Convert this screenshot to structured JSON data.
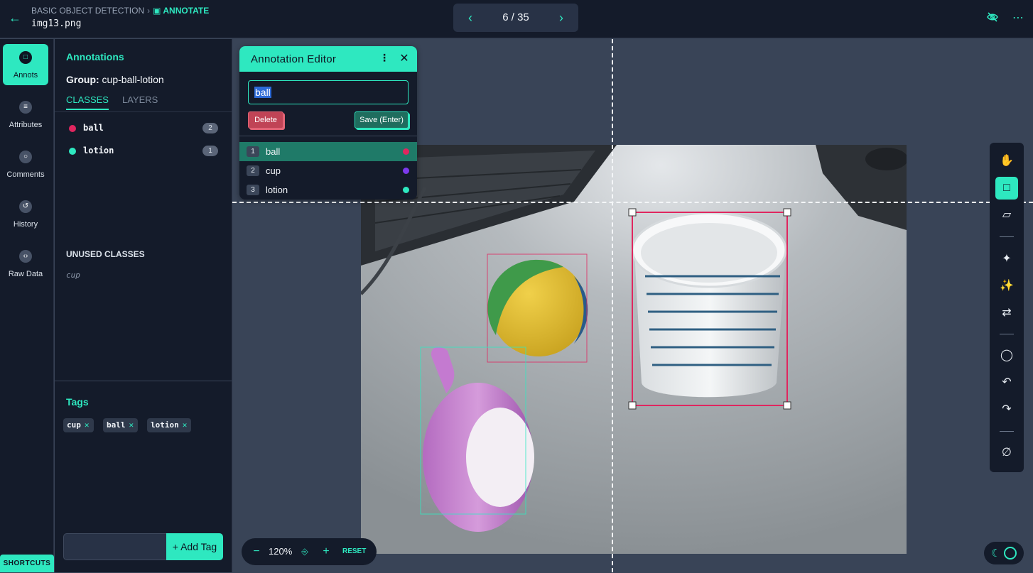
{
  "header": {
    "breadcrumb_project": "BASIC OBJECT DETECTION",
    "breadcrumb_current": "ANNOTATE",
    "filename": "img13.png",
    "pager": "6 / 35"
  },
  "nav": {
    "items": [
      {
        "label": "Annots",
        "icon": "annotation-icon"
      },
      {
        "label": "Attributes",
        "icon": "list-icon"
      },
      {
        "label": "Comments",
        "icon": "comment-icon"
      },
      {
        "label": "History",
        "icon": "history-icon"
      },
      {
        "label": "Raw Data",
        "icon": "code-icon"
      }
    ],
    "shortcuts": "SHORTCUTS"
  },
  "panel": {
    "title": "Annotations",
    "group_label": "Group:",
    "group_value": "cup-ball-lotion",
    "tab_classes": "CLASSES",
    "tab_layers": "LAYERS",
    "classes": [
      {
        "name": "ball",
        "count": "2",
        "color": "#e0265f"
      },
      {
        "name": "lotion",
        "count": "1",
        "color": "#2ee8c0"
      }
    ],
    "unused_title": "UNUSED CLASSES",
    "unused": [
      "cup"
    ],
    "tags_title": "Tags",
    "tags": [
      "cup",
      "ball",
      "lotion"
    ],
    "add_tag": "+ Add Tag"
  },
  "editor": {
    "title": "Annotation Editor",
    "input_value": "ball",
    "delete": "Delete",
    "save": "Save (Enter)",
    "options": [
      {
        "num": "1",
        "name": "ball",
        "color": "#e0265f"
      },
      {
        "num": "2",
        "name": "cup",
        "color": "#7c3aed"
      },
      {
        "num": "3",
        "name": "lotion",
        "color": "#2ee8c0"
      }
    ]
  },
  "zoom": {
    "value": "120%",
    "reset": "RESET"
  },
  "colors": {
    "accent": "#2ee8c0",
    "ball": "#e0265f",
    "cup": "#7c3aed",
    "lotion": "#2ee8c0"
  }
}
